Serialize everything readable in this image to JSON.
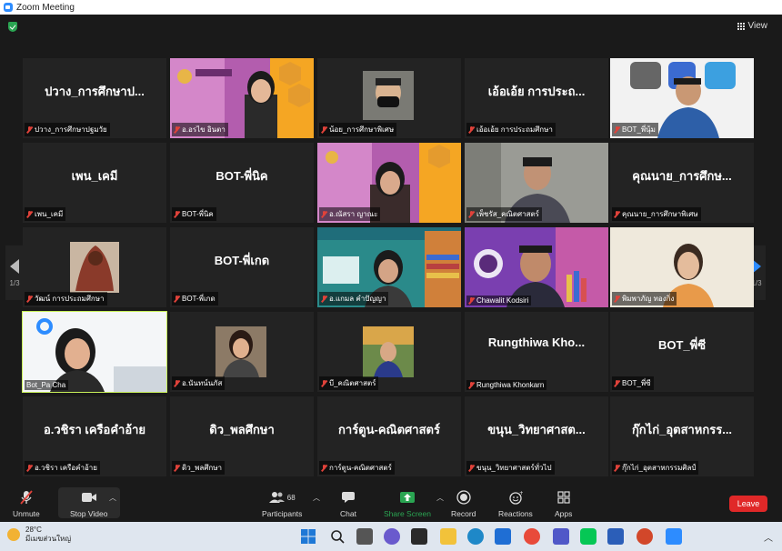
{
  "window": {
    "title": "Zoom Meeting"
  },
  "topbar": {
    "view_label": "View"
  },
  "pager": {
    "left": "1/3",
    "right": "1/3"
  },
  "tiles": [
    {
      "big": "ปวาง_การศึกษาป...",
      "label": "ปวาง_การศึกษาปฐมวัย"
    },
    {
      "big": "",
      "label": "อ.อรไข อินตา"
    },
    {
      "big": "",
      "label": "น้อย_การศึกษาพิเศษ"
    },
    {
      "big": "เอ้อเอ้ย การประถ...",
      "label": "เอ้อเอ้ย การประถมศึกษา"
    },
    {
      "big": "",
      "label": "BOT_พี่นุ้ม"
    },
    {
      "big": "เพน_เคมี",
      "label": "เพน_เคมี"
    },
    {
      "big": "BOT-พี่นิค",
      "label": "BOT-พี่นิค"
    },
    {
      "big": "",
      "label": "อ.ณัสรา ญาณะ"
    },
    {
      "big": "",
      "label": "เพ็ชรัส_คณิตศาสตร์"
    },
    {
      "big": "คุณนาย_การศึกษ...",
      "label": "คุณนาย_การศึกษาพิเศษ"
    },
    {
      "big": "",
      "label": "วัฒน์ การประถมศึกษา"
    },
    {
      "big": "BOT-พี่เกด",
      "label": "BOT-พี่เกด"
    },
    {
      "big": "",
      "label": "อ.แกมล คำปัญญา"
    },
    {
      "big": "",
      "label": "Chawalit Kodsiri"
    },
    {
      "big": "",
      "label": "พิมพาภัญ ทองกิ่ง"
    },
    {
      "big": "",
      "label": "Bot_Pa Cha"
    },
    {
      "big": "",
      "label": "อ.นันทน์นภัส"
    },
    {
      "big": "",
      "label": "บี_คณิตศาสตร์"
    },
    {
      "big": "Rungthiwa   Kho...",
      "label": "Rungthiwa  Khonkarn"
    },
    {
      "big": "BOT_พี่ซี",
      "label": "BOT_พี่ซี"
    },
    {
      "big": "อ.วชิรา เครือคำอ้าย",
      "label": "อ.วชิรา เครือคำอ้าย"
    },
    {
      "big": "ดิว_พลศึกษา",
      "label": "ดิว_พลศึกษา"
    },
    {
      "big": "การ์ตูน-คณิตศาสตร์",
      "label": "การ์ตูน-คณิตศาสตร์"
    },
    {
      "big": "ขนุน_วิทยาศาสต...",
      "label": "ขนุน_วิทยาศาสตร์ทั่วไป"
    },
    {
      "big": "กุ๊กไก่_อุตสาหกรร...",
      "label": "กุ๊กไก่_อุตสาหกรรมศิลป์"
    }
  ],
  "toolbar": {
    "unmute": "Unmute",
    "stop_video": "Stop Video",
    "participants": "Participants",
    "participants_count": "68",
    "chat": "Chat",
    "share_screen": "Share Screen",
    "record": "Record",
    "reactions": "Reactions",
    "apps": "Apps",
    "leave": "Leave"
  },
  "taskbar": {
    "temp": "28°C",
    "weather": "มีเมฆส่วนใหญ่"
  },
  "colors": {
    "zoom_blue": "#2D8CFF",
    "leave_red": "#E02828",
    "share_green": "#2AA552",
    "active_speaker": "#C8F05A"
  }
}
